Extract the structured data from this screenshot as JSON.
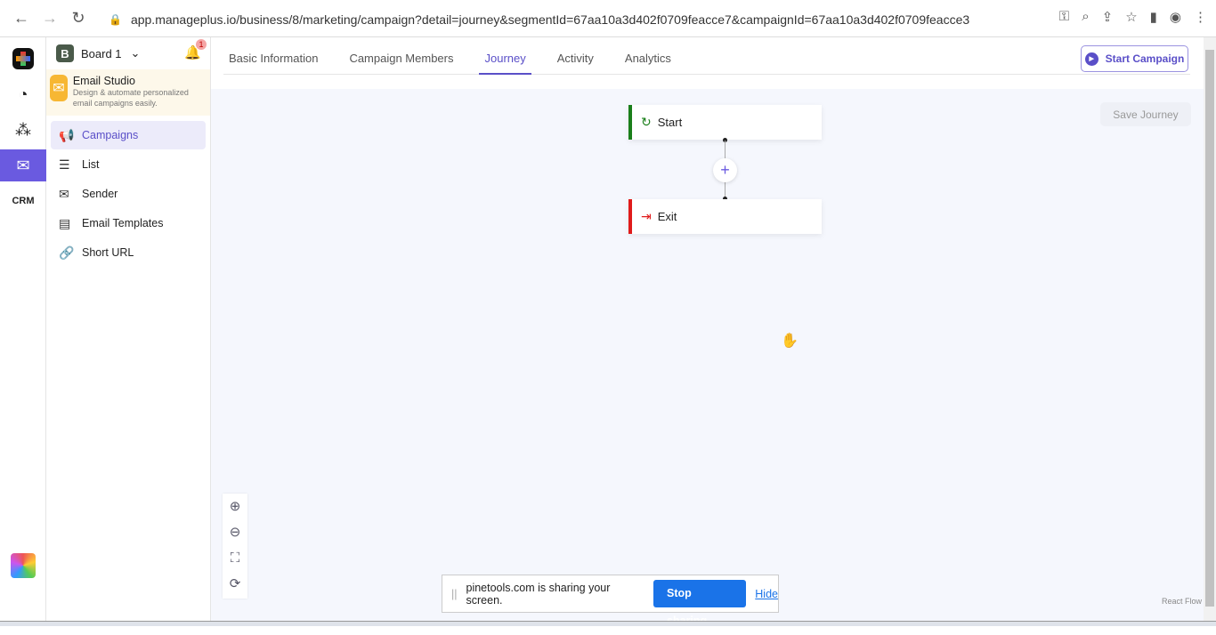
{
  "browser": {
    "url": "app.manageplus.io/business/8/marketing/campaign?detail=journey&segmentId=67aa10a3d402f0709feacce7&campaignId=67aa10a3d402f0709feacce3"
  },
  "sidebar": {
    "board": {
      "badge": "B",
      "label": "Board 1"
    },
    "notification_count": "1",
    "app": {
      "title": "Email Studio",
      "description": "Design & automate personalized email campaigns easily."
    },
    "items": [
      {
        "label": "Campaigns",
        "icon": "megaphone-icon"
      },
      {
        "label": "List",
        "icon": "list-icon"
      },
      {
        "label": "Sender",
        "icon": "sender-icon"
      },
      {
        "label": "Email Templates",
        "icon": "template-icon"
      },
      {
        "label": "Short URL",
        "icon": "link-icon"
      }
    ]
  },
  "tabs": [
    {
      "label": "Basic Information"
    },
    {
      "label": "Campaign Members"
    },
    {
      "label": "Journey",
      "active": true
    },
    {
      "label": "Activity"
    },
    {
      "label": "Analytics"
    }
  ],
  "actions": {
    "start_campaign": "Start Campaign",
    "save_journey": "Save Journey"
  },
  "flow": {
    "nodes": [
      {
        "label": "Start",
        "color": "#1a7f1a"
      },
      {
        "label": "Exit",
        "color": "#e01b1b"
      }
    ],
    "add": "+",
    "attribution": "React Flow"
  },
  "share_bar": {
    "message": "pinetools.com is sharing your screen.",
    "stop": "Stop sharing",
    "hide": "Hide"
  },
  "colors": {
    "accent": "#5a4fc8"
  }
}
